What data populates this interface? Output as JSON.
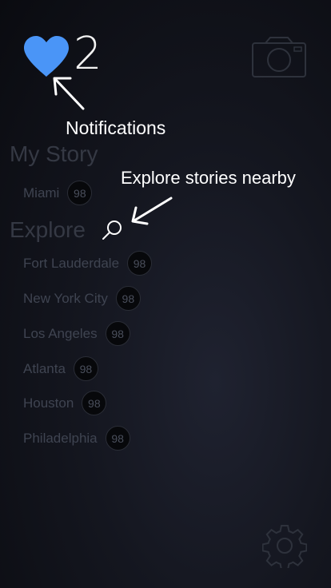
{
  "header": {
    "notification_count": "2",
    "heart_color": "#4a95f7"
  },
  "hints": {
    "notifications": "Notifications",
    "explore": "Explore stories nearby"
  },
  "my_story": {
    "title": "My Story",
    "items": [
      {
        "name": "Miami",
        "count": "98"
      }
    ]
  },
  "explore": {
    "title": "Explore",
    "items": [
      {
        "name": "Fort Lauderdale",
        "count": "98"
      },
      {
        "name": "New York City",
        "count": "98"
      },
      {
        "name": "Los Angeles",
        "count": "98"
      },
      {
        "name": "Atlanta",
        "count": "98"
      },
      {
        "name": "Houston",
        "count": "98"
      },
      {
        "name": "Philadelphia",
        "count": "98"
      }
    ]
  },
  "icons": {
    "heart": "heart-icon",
    "camera": "camera-icon",
    "search": "search-icon",
    "settings": "gear-icon"
  }
}
